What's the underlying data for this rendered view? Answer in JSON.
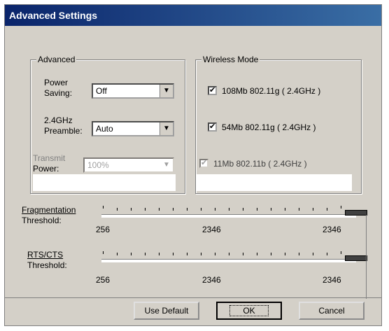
{
  "window": {
    "title": "Advanced Settings"
  },
  "advanced": {
    "title": "Advanced",
    "power_saving_label_1": "Power",
    "power_saving_label_2": "Saving:",
    "power_saving_value": "Off",
    "preamble_label_1": "2.4GHz",
    "preamble_label_2": "Preamble:",
    "preamble_value": "Auto",
    "transmit_label_1": "Transmit",
    "transmit_label_2": "Power:",
    "transmit_value": "100%"
  },
  "wireless": {
    "title": "Wireless Mode",
    "modes": [
      {
        "label": "108Mb 802.11g ( 2.4GHz )",
        "checked": true,
        "enabled": true
      },
      {
        "label": "54Mb 802.11g ( 2.4GHz )",
        "checked": true,
        "enabled": true
      },
      {
        "label": "11Mb 802.11b ( 2.4GHz )",
        "checked": true,
        "enabled": false
      }
    ]
  },
  "fragmentation": {
    "label_1": "Fragmentation",
    "label_2": "Threshold:",
    "min": "256",
    "mid": "2346",
    "max": "2346",
    "value": 2346
  },
  "rts": {
    "label_1": "RTS/CTS",
    "label_2": "Threshold:",
    "min": "256",
    "mid": "2346",
    "max": "2346",
    "value": 2346
  },
  "buttons": {
    "use_default": "Use Default",
    "ok": "OK",
    "cancel": "Cancel"
  }
}
